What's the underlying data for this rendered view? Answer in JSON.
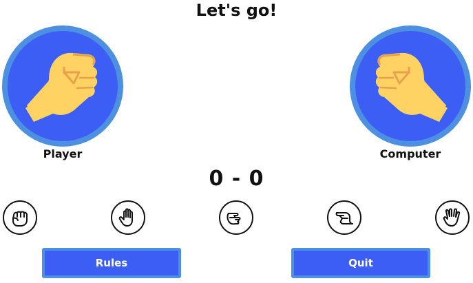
{
  "header": {
    "title": "Let's go!"
  },
  "player": {
    "name": "Player",
    "avatar_icon": "fist-icon"
  },
  "computer": {
    "name": "Computer",
    "avatar_icon": "fist-icon"
  },
  "score": {
    "player": 0,
    "computer": 0,
    "display": "0 - 0"
  },
  "choices": [
    {
      "icon": "rock-hand-icon"
    },
    {
      "icon": "paper-hand-icon"
    },
    {
      "icon": "scissors-hand-icon"
    },
    {
      "icon": "lizard-hand-icon"
    },
    {
      "icon": "spock-hand-icon"
    }
  ],
  "buttons": {
    "rules_label": "Rules",
    "quit_label": "Quit"
  },
  "colors": {
    "accent": "#3d5ef5",
    "accent_border": "#4d8fe0",
    "hand_fill": "#ffd363",
    "hand_shadow": "#e8a14a"
  }
}
